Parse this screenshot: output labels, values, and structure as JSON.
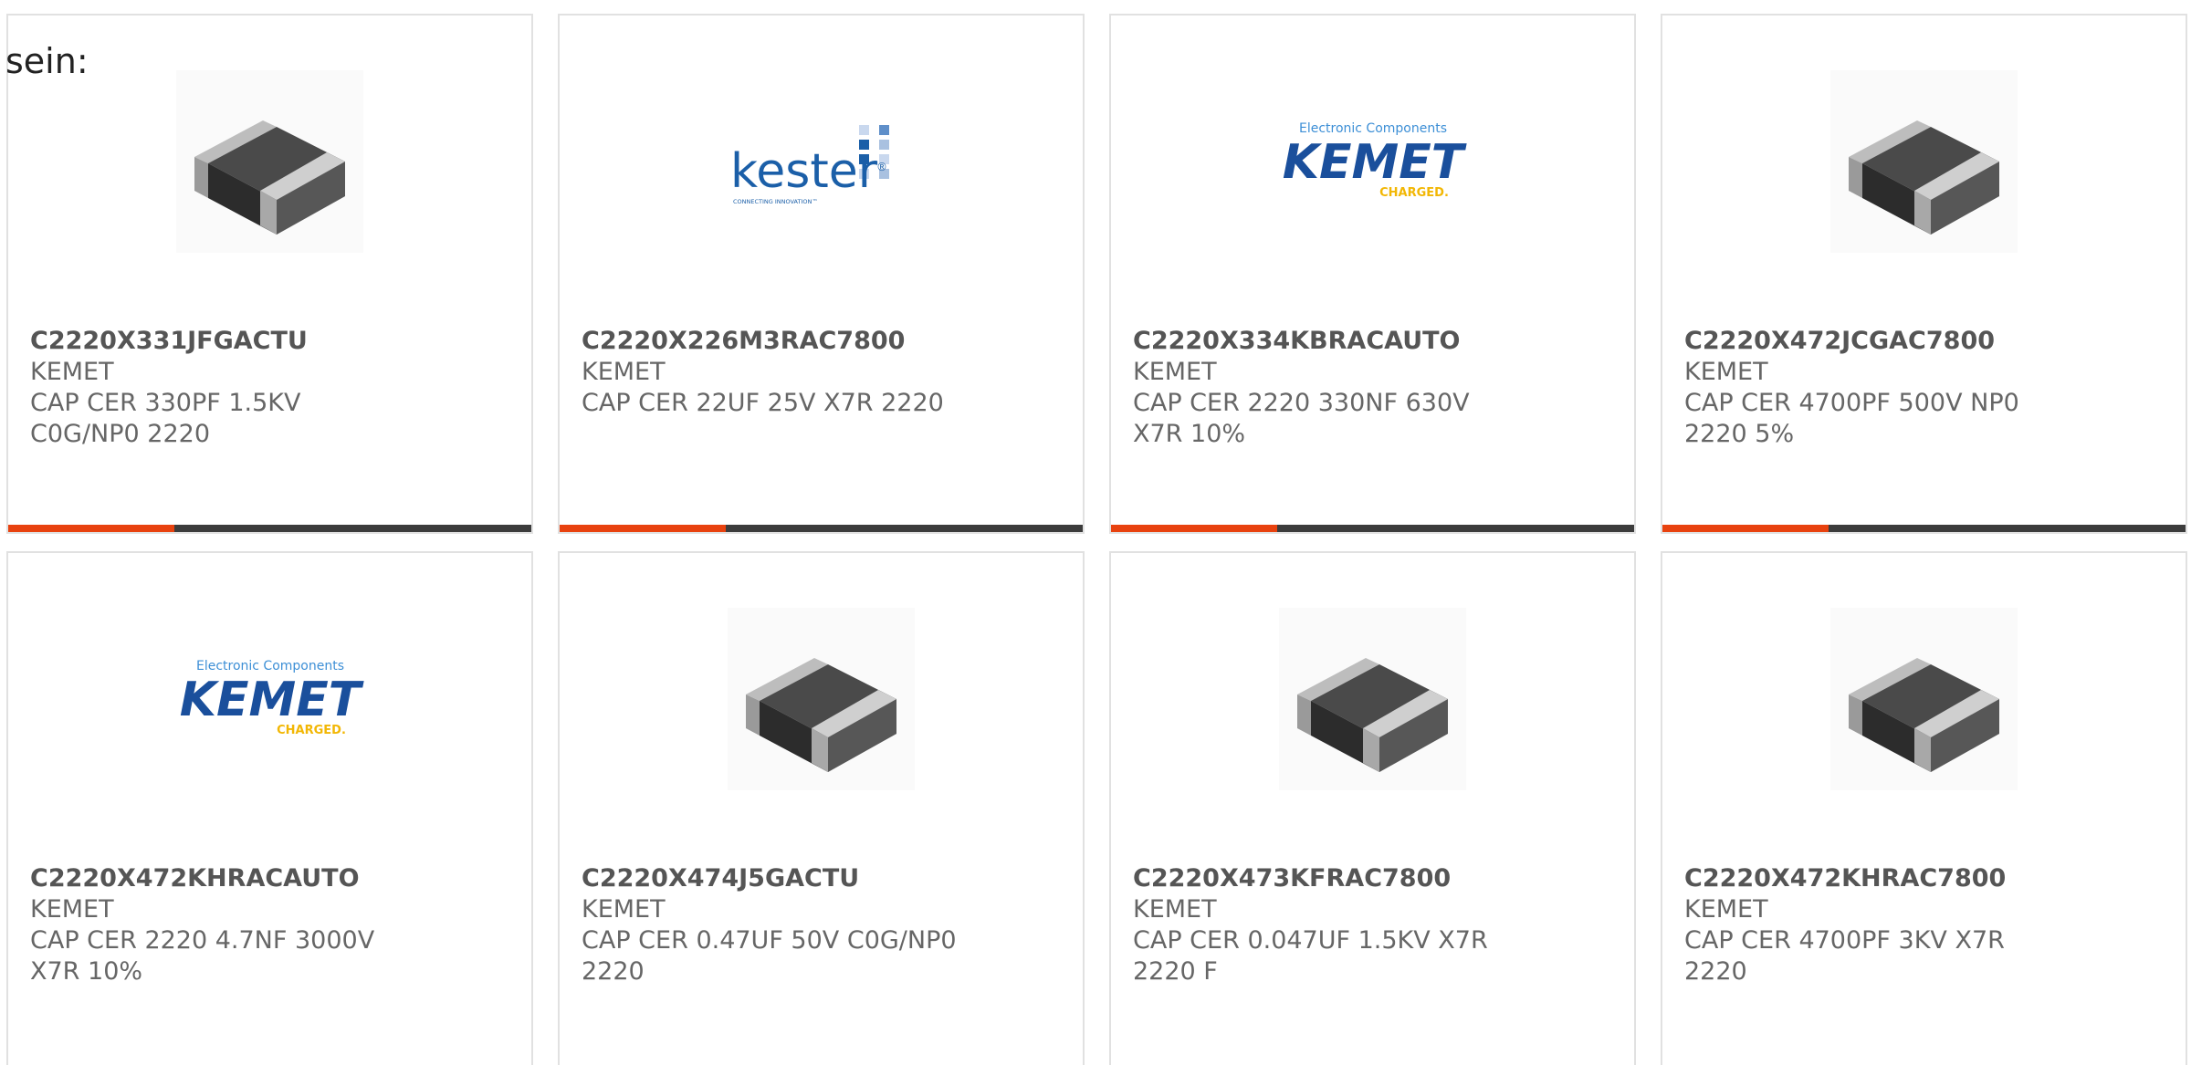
{
  "intro_text": "sein:",
  "colors": {
    "accent": "#e8420f",
    "bar": "#3c3c3c",
    "kemet_blue": "#1a4f9c",
    "kemet_light_blue": "#3d8fd6",
    "kemet_yellow": "#f2b705",
    "kester_blue": "#1b5fa8"
  },
  "products": [
    {
      "part_number": "C2220X331JFGACTU",
      "manufacturer": "KEMET",
      "description": "CAP CER 330PF 1.5KV C0G/NP0 2220",
      "image": "chip-capacitor",
      "has_accent_bar": true
    },
    {
      "part_number": "C2220X226M3RAC7800",
      "manufacturer": "KEMET",
      "description": "CAP CER 22UF 25V X7R 2220",
      "image": "kester-logo",
      "logo_text": "kester",
      "logo_tagline": "CONNECTING INNOVATION",
      "has_accent_bar": true
    },
    {
      "part_number": "C2220X334KBRACAUTO",
      "manufacturer": "KEMET",
      "description": "CAP CER 2220 330NF 630V X7R 10%",
      "image": "kemet-logo",
      "logo_top": "Electronic Components",
      "logo_text": "KEMET",
      "logo_bottom": "CHARGED.",
      "has_accent_bar": true
    },
    {
      "part_number": "C2220X472JCGAC7800",
      "manufacturer": "KEMET",
      "description": "CAP CER 4700PF 500V NP0 2220 5%",
      "image": "chip-capacitor",
      "has_accent_bar": true
    },
    {
      "part_number": "C2220X472KHRACAUTO",
      "manufacturer": "KEMET",
      "description": "CAP CER 2220 4.7NF 3000V X7R 10%",
      "image": "kemet-logo",
      "logo_top": "Electronic Components",
      "logo_text": "KEMET",
      "logo_bottom": "CHARGED.",
      "has_accent_bar": false
    },
    {
      "part_number": "C2220X474J5GACTU",
      "manufacturer": "KEMET",
      "description": "CAP CER 0.47UF 50V C0G/NP0 2220",
      "image": "chip-capacitor",
      "has_accent_bar": false
    },
    {
      "part_number": "C2220X473KFRAC7800",
      "manufacturer": "KEMET",
      "description": "CAP CER 0.047UF 1.5KV X7R 2220 F",
      "image": "chip-capacitor",
      "has_accent_bar": false
    },
    {
      "part_number": "C2220X472KHRAC7800",
      "manufacturer": "KEMET",
      "description": "CAP CER 4700PF 3KV X7R 2220",
      "image": "chip-capacitor",
      "has_accent_bar": false
    }
  ]
}
